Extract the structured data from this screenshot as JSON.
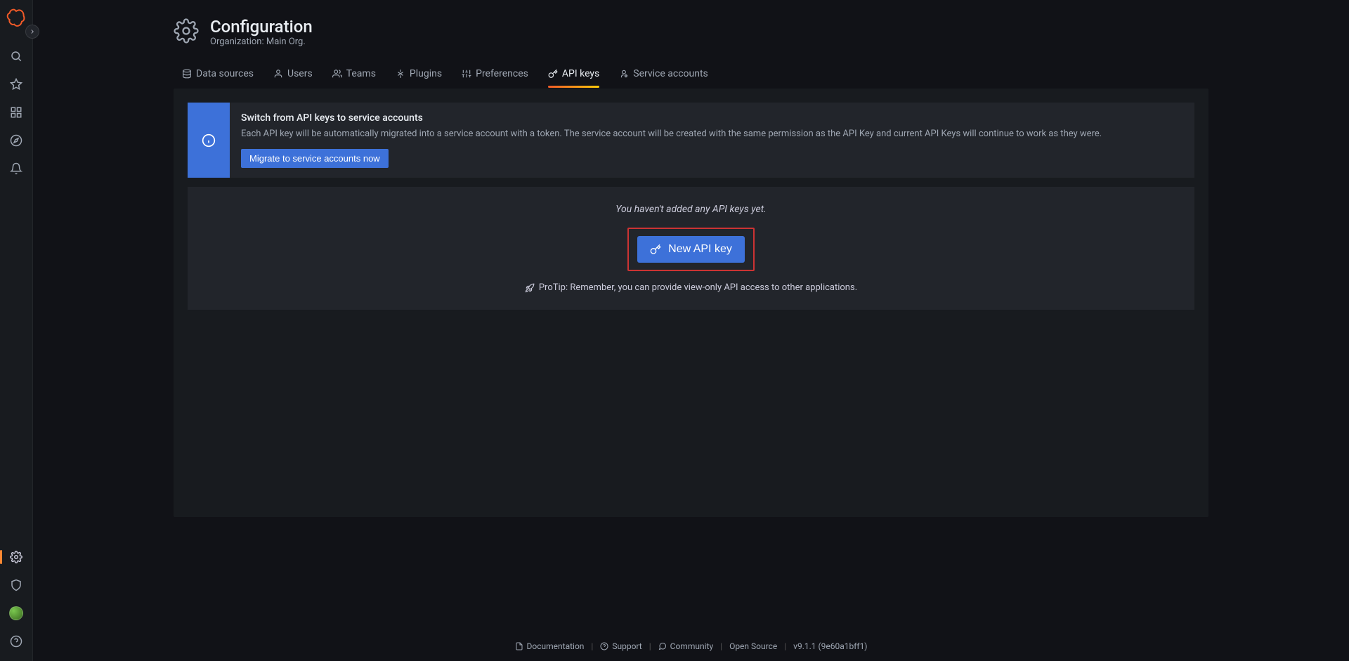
{
  "page": {
    "title": "Configuration",
    "subtitle": "Organization: Main Org."
  },
  "tabs": {
    "data_sources": "Data sources",
    "users": "Users",
    "teams": "Teams",
    "plugins": "Plugins",
    "preferences": "Preferences",
    "api_keys": "API keys",
    "service_accounts": "Service accounts"
  },
  "banner": {
    "title": "Switch from API keys to service accounts",
    "text": "Each API key will be automatically migrated into a service account with a token. The service account will be created with the same permission as the API Key and current API Keys will continue to work as they were.",
    "button": "Migrate to service accounts now"
  },
  "empty": {
    "message": "You haven't added any API keys yet.",
    "button": "New API key",
    "protip": "ProTip: Remember, you can provide view-only API access to other applications."
  },
  "footer": {
    "documentation": "Documentation",
    "support": "Support",
    "community": "Community",
    "open_source": "Open Source",
    "version": "v9.1.1 (9e60a1bff1)"
  }
}
